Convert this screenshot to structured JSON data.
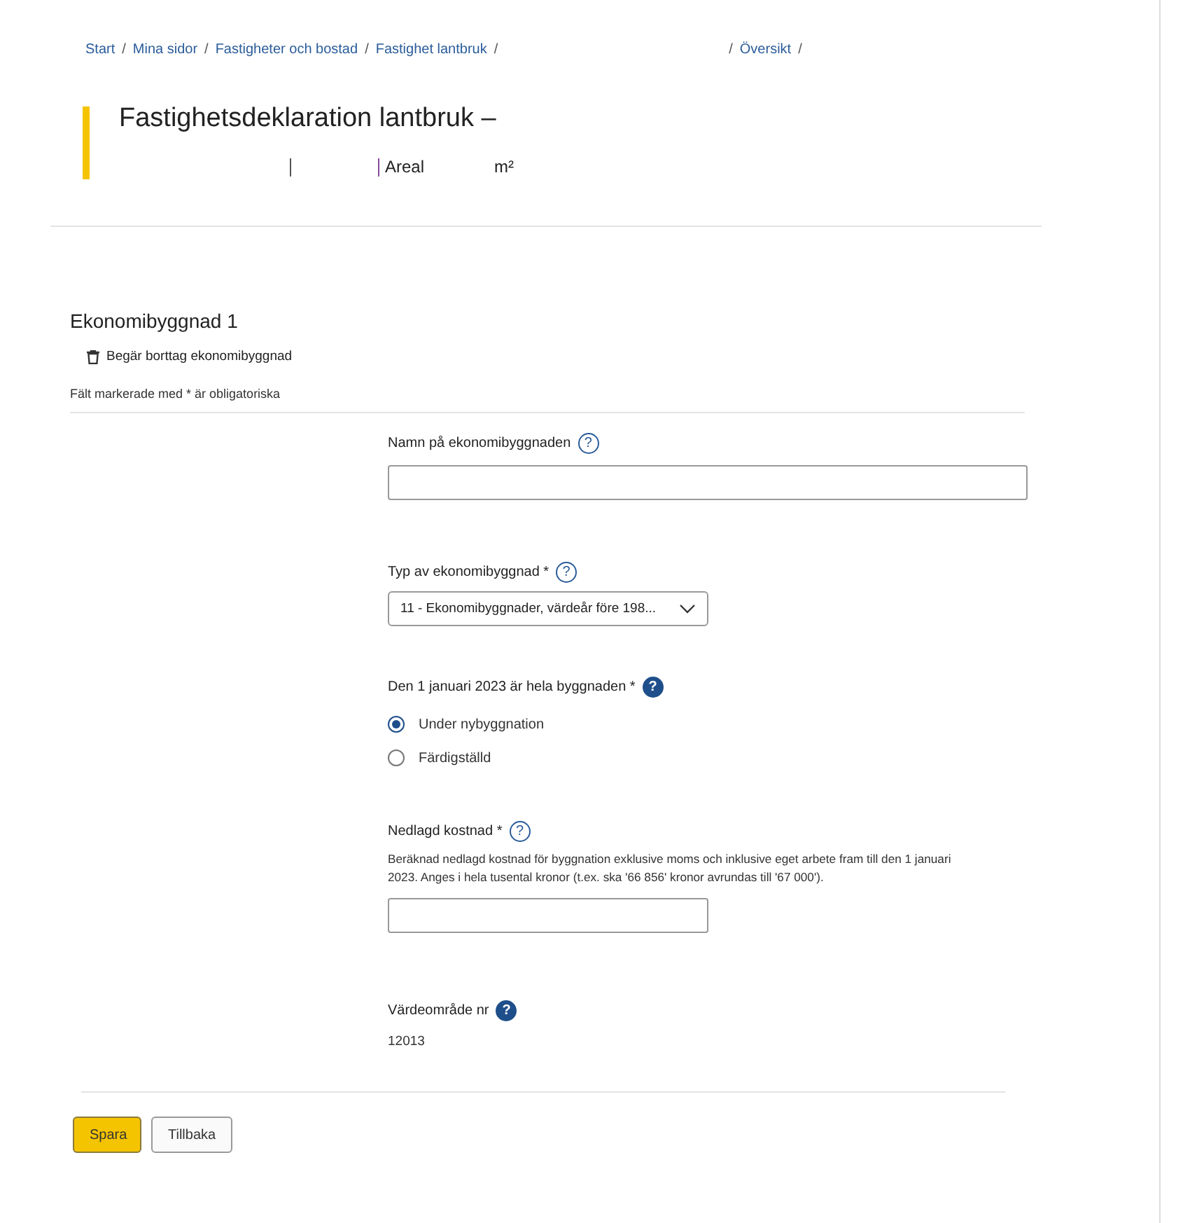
{
  "breadcrumb": {
    "leading": [
      {
        "label": "Start"
      },
      {
        "label": "Mina sidor"
      },
      {
        "label": "Fastigheter och bostad"
      },
      {
        "label": "Fastighet lantbruk"
      }
    ],
    "trailing": [
      {
        "label": "Översikt"
      }
    ]
  },
  "breadcrumb_separator": "/",
  "header": {
    "title": "Fastighetsdeklaration lantbruk –",
    "area_label": "Areal",
    "area_unit": "m²"
  },
  "section": {
    "title": "Ekonomibyggnad 1",
    "delete_link": "Begär borttag ekonomibyggnad",
    "required_note": "Fält markerade med * är obligatoriska"
  },
  "fields": [
    {
      "kind": "text",
      "label": "Namn på ekonomibyggnaden",
      "help": {
        "mark": "?",
        "filled": false
      },
      "wide": true
    },
    {
      "kind": "select",
      "label": "Typ av ekonomibyggnad *",
      "help": {
        "mark": "?",
        "filled": false
      },
      "value": "11 - Ekonomibyggnader, värdeår före 198..."
    },
    {
      "kind": "radio",
      "label": "Den 1 januari 2023 är hela byggnaden *",
      "help": {
        "mark": "?",
        "filled": true
      },
      "options": [
        {
          "label": "Under nybyggnation",
          "selected": true
        },
        {
          "label": "Färdigställd",
          "selected": false
        }
      ]
    },
    {
      "kind": "text",
      "label": "Nedlagd kostnad *",
      "help": {
        "mark": "?",
        "filled": false
      },
      "wide": false,
      "description": "Beräknad nedlagd kostnad för byggnation exklusive moms och inklusive eget arbete fram till den 1 januari 2023. Anges i hela tusental kronor (t.ex. ska '66 856' kronor avrundas till '67 000')."
    },
    {
      "kind": "readonly",
      "label": "Värdeområde nr",
      "help": {
        "mark": "?",
        "filled": true
      },
      "value": "12013"
    }
  ],
  "buttons": [
    {
      "label": "Spara",
      "primary": true
    },
    {
      "label": "Tillbaka",
      "primary": false
    }
  ]
}
